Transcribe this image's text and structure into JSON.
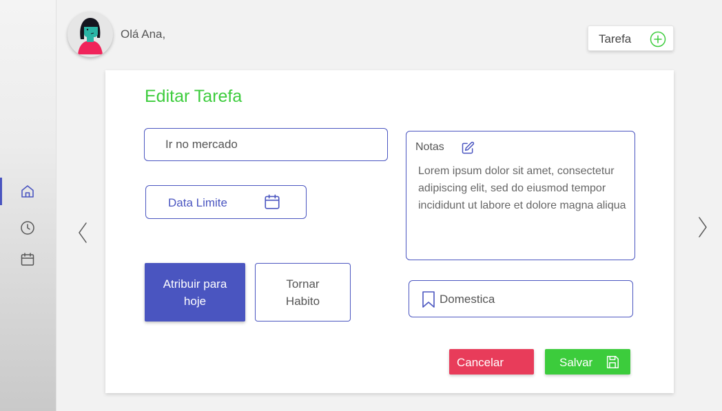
{
  "header": {
    "greeting": "Olá Ana,",
    "new_task_label": "Tarefa"
  },
  "sidebar": {
    "items": [
      {
        "icon": "home-icon",
        "active": true
      },
      {
        "icon": "clock-icon",
        "active": false
      },
      {
        "icon": "calendar-icon",
        "active": false
      }
    ]
  },
  "form": {
    "title": "Editar Tarefa",
    "task_name_value": "Ir no mercado",
    "deadline_label": "Data Limite",
    "notes_label": "Notas",
    "notes_text": "Lorem ipsum dolor sit amet, consectetur adipiscing elit, sed do eiusmod tempor incididunt ut labore et dolore magna aliqua",
    "assign_today_label": "Atribuir para hoje",
    "make_habit_label": "Tornar Habito",
    "category_label": "Domestica",
    "cancel_label": "Cancelar",
    "save_label": "Salvar"
  },
  "colors": {
    "accent": "#4a55c0",
    "title_green": "#3ccc3c",
    "save_green": "#3ccc3c",
    "cancel_red": "#e83c5a"
  }
}
